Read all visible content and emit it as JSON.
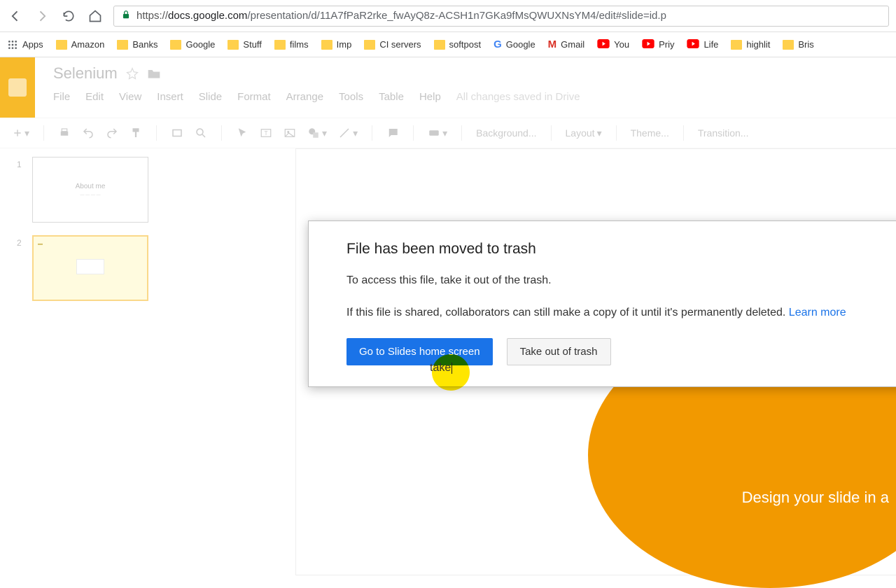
{
  "url": {
    "scheme": "https://",
    "domain": "docs.google.com",
    "path": "/presentation/d/11A7fPaR2rke_fwAyQ8z-ACSH1n7GKa9fMsQWUXNsYM4/edit#slide=id.p"
  },
  "bookmarks": {
    "apps": "Apps",
    "items": [
      {
        "label": "Amazon",
        "icon": "folder"
      },
      {
        "label": "Banks",
        "icon": "folder"
      },
      {
        "label": "Google",
        "icon": "folder"
      },
      {
        "label": "Stuff",
        "icon": "folder"
      },
      {
        "label": "films",
        "icon": "folder"
      },
      {
        "label": "Imp",
        "icon": "folder"
      },
      {
        "label": "CI servers",
        "icon": "folder"
      },
      {
        "label": "softpost",
        "icon": "folder"
      },
      {
        "label": "Google",
        "icon": "g"
      },
      {
        "label": "Gmail",
        "icon": "m"
      },
      {
        "label": "You",
        "icon": "yt"
      },
      {
        "label": "Priy",
        "icon": "yt"
      },
      {
        "label": "Life",
        "icon": "yt"
      },
      {
        "label": "highlit",
        "icon": "folder"
      },
      {
        "label": "Bris",
        "icon": "folder"
      }
    ]
  },
  "app": {
    "title": "Selenium",
    "menu": [
      "File",
      "Edit",
      "View",
      "Insert",
      "Slide",
      "Format",
      "Arrange",
      "Tools",
      "Table",
      "Help"
    ],
    "save_state": "All changes saved in Drive"
  },
  "toolbar": {
    "bg": "Background...",
    "layout": "Layout",
    "theme": "Theme...",
    "transition": "Transition..."
  },
  "thumbnails": {
    "n1": "1",
    "n2": "2",
    "slide1_title": "About me"
  },
  "dialog": {
    "title": "File has been moved to trash",
    "line1": "To access this file, take it out of the trash.",
    "line2_pre": "If this file is shared, collaborators can still make a copy of it until it's permanently deleted. ",
    "learn": "Learn more",
    "primary": "Go to Slides home screen",
    "secondary": "Take out of trash"
  },
  "highlight_text": "take",
  "corner_text": "Design your slide in a"
}
